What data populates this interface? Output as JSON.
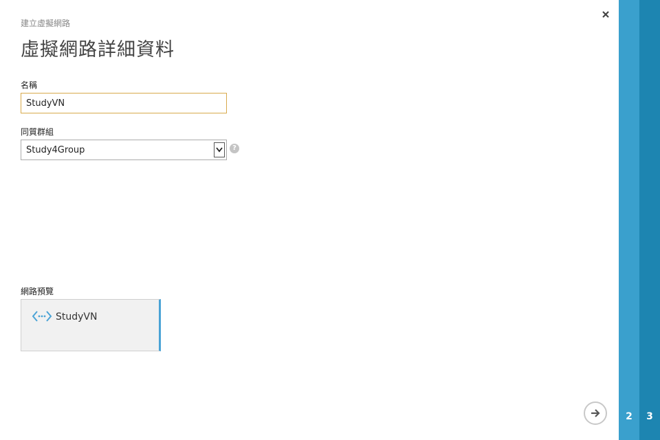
{
  "wizard": {
    "breadcrumb": "建立虛擬網路",
    "title": "虛擬網路詳細資料"
  },
  "form": {
    "name_label": "名稱",
    "name_value": "StudyVN",
    "affinity_group_label": "同質群組",
    "affinity_group_value": "Study4Group",
    "help_glyph": "?"
  },
  "preview": {
    "label": "網路預覽",
    "network_name": "StudyVN",
    "icon": "virtual-network-icon"
  },
  "steps": [
    {
      "number": "2",
      "color": "#3aa0cd"
    },
    {
      "number": "3",
      "color": "#1d85b1"
    }
  ],
  "controls": {
    "close_icon": "close-icon",
    "next_icon": "arrow-right-icon"
  },
  "colors": {
    "accent": "#3aa0cd",
    "accent_dark": "#1d85b1",
    "input_focus_border": "#d8a94a",
    "preview_bar": "#4aa3d6"
  }
}
